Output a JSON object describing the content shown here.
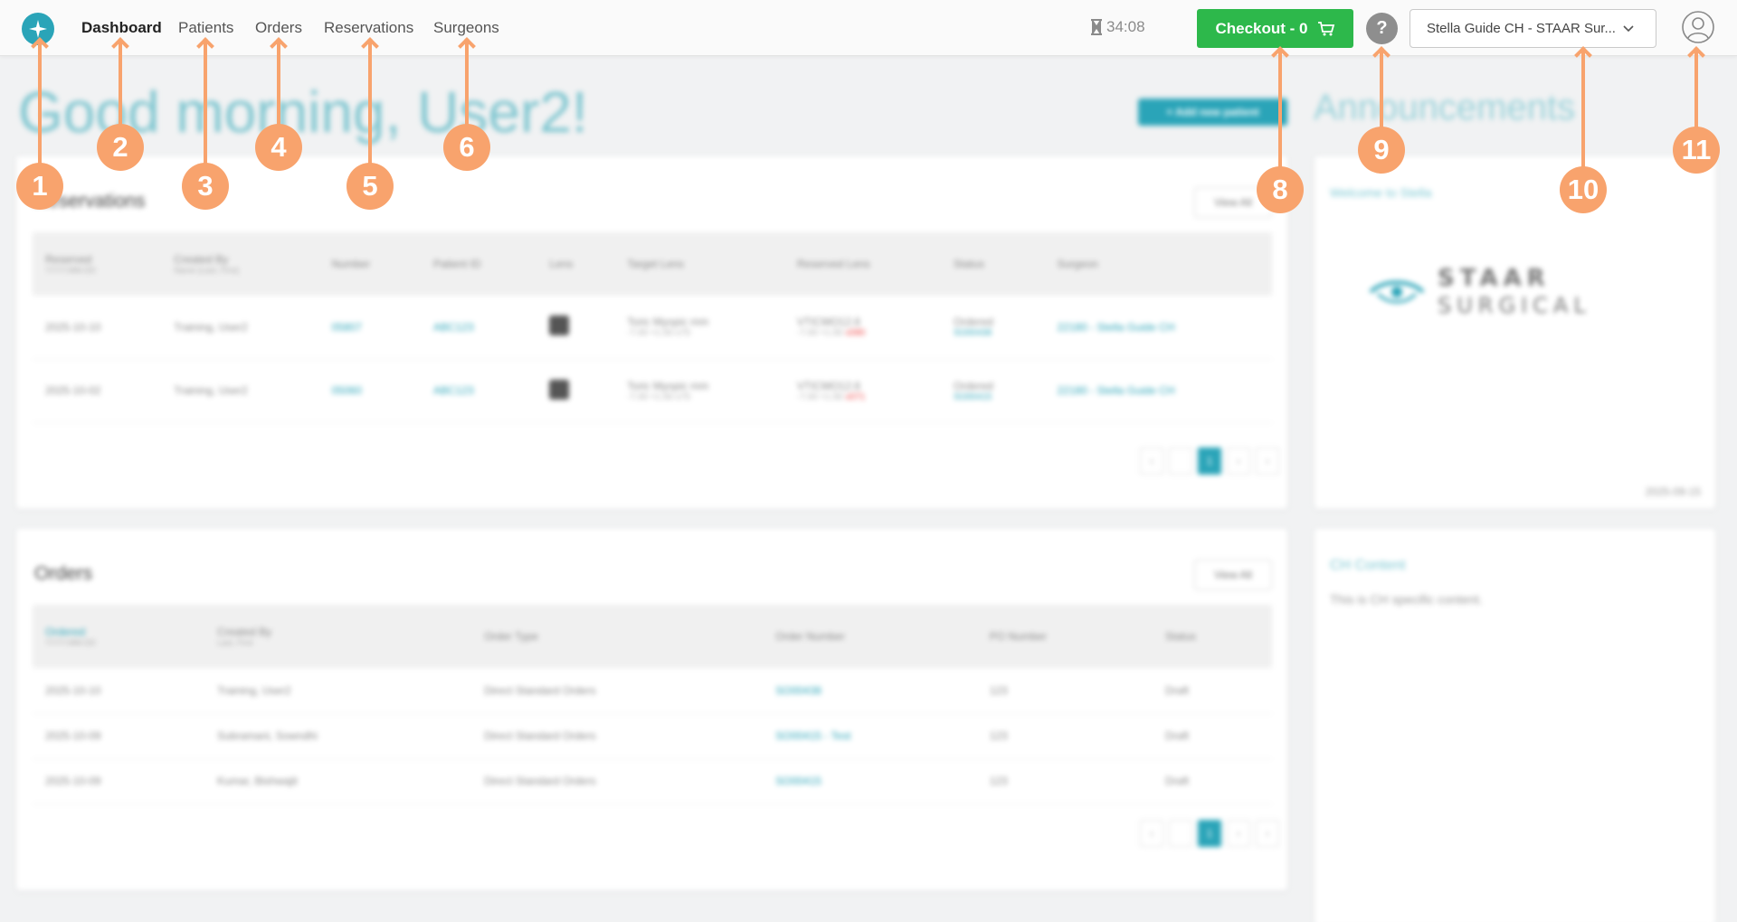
{
  "nav": {
    "items": [
      {
        "label": "Dashboard",
        "active": true
      },
      {
        "label": "Patients",
        "active": false
      },
      {
        "label": "Orders",
        "active": false
      },
      {
        "label": "Reservations",
        "active": false
      },
      {
        "label": "Surgeons",
        "active": false
      }
    ],
    "timer": "34:08",
    "checkout_label": "Checkout - 0",
    "help_label": "?",
    "site_selector": "Stella Guide CH - STAAR Sur..."
  },
  "greeting": "Good morning, User2!",
  "add_patient_label": "+ Add new patient",
  "reservations": {
    "title": "Reservations",
    "view_all": "View All",
    "columns": [
      {
        "label": "Reserved",
        "sub": "YYYY.MM.DD"
      },
      {
        "label": "Created By",
        "sub": "Name (Last, First)"
      },
      {
        "label": "Number",
        "sub": ""
      },
      {
        "label": "Patient ID",
        "sub": ""
      },
      {
        "label": "Lens",
        "sub": ""
      },
      {
        "label": "Target Lens",
        "sub": ""
      },
      {
        "label": "Reserved Lens",
        "sub": ""
      },
      {
        "label": "Status",
        "sub": ""
      },
      {
        "label": "Surgeon",
        "sub": ""
      }
    ],
    "rows": [
      {
        "reserved": "2025-10-10",
        "created_by": "Training, User2",
        "number": "05807",
        "patient_id": "ABC123",
        "target_lens": "Toric Myopic mm",
        "target_sub": "-7.00 +1.50 x75",
        "reserved_lens": "VTICMO12.6",
        "reserved_sub": "-7.00 +1.50",
        "reserved_flag": "x080",
        "status": "Ordered",
        "status_link": "SO00438",
        "surgeon": "22180 - Stella Guide CH"
      },
      {
        "reserved": "2025-10-02",
        "created_by": "Training, User2",
        "number": "05060",
        "patient_id": "ABC123",
        "target_lens": "Toric Myopic mm",
        "target_sub": "-7.00 +1.50 x75",
        "reserved_lens": "VTICMO12.6",
        "reserved_sub": "-7.00 +1.50",
        "reserved_flag": "x071",
        "status": "Ordered",
        "status_link": "SO00415",
        "surgeon": "22180 - Stella Guide CH"
      }
    ],
    "page": "1"
  },
  "orders": {
    "title": "Orders",
    "view_all": "View All",
    "columns": [
      {
        "label": "Ordered",
        "sub": "YYYY.MM.DD"
      },
      {
        "label": "Created By",
        "sub": "Last, First"
      },
      {
        "label": "Order Type",
        "sub": ""
      },
      {
        "label": "Order Number",
        "sub": ""
      },
      {
        "label": "PO Number",
        "sub": ""
      },
      {
        "label": "Status",
        "sub": ""
      }
    ],
    "rows": [
      {
        "ordered": "2025-10-10",
        "created_by": "Training, User2",
        "type": "Direct Standard Orders",
        "number": "SO00438",
        "po": "123",
        "status": "Draft"
      },
      {
        "ordered": "2025-10-09",
        "created_by": "Subramani, Sowndhi",
        "type": "Direct Standard Orders",
        "number": "SO00415 - Test",
        "po": "123",
        "status": "Draft"
      },
      {
        "ordered": "2025-10-09",
        "created_by": "Kumar, Bishwajit",
        "type": "Direct Standard Orders",
        "number": "SO00415",
        "po": "123",
        "status": "Draft"
      }
    ],
    "page": "1"
  },
  "announcements": {
    "title": "Announcements",
    "welcome": "Welcome to Stella",
    "logo_line1": "STAAR",
    "logo_line2": "SURGICAL",
    "date": "2025-09-15"
  },
  "ch_content": {
    "title": "CH Content",
    "text": "This is CH specific content."
  },
  "callouts": [
    "1",
    "2",
    "3",
    "4",
    "5",
    "6",
    "8",
    "9",
    "10",
    "11"
  ],
  "colors": {
    "accent": "#2aa4b8",
    "checkout": "#2db84b",
    "callout": "#f8a36d"
  }
}
